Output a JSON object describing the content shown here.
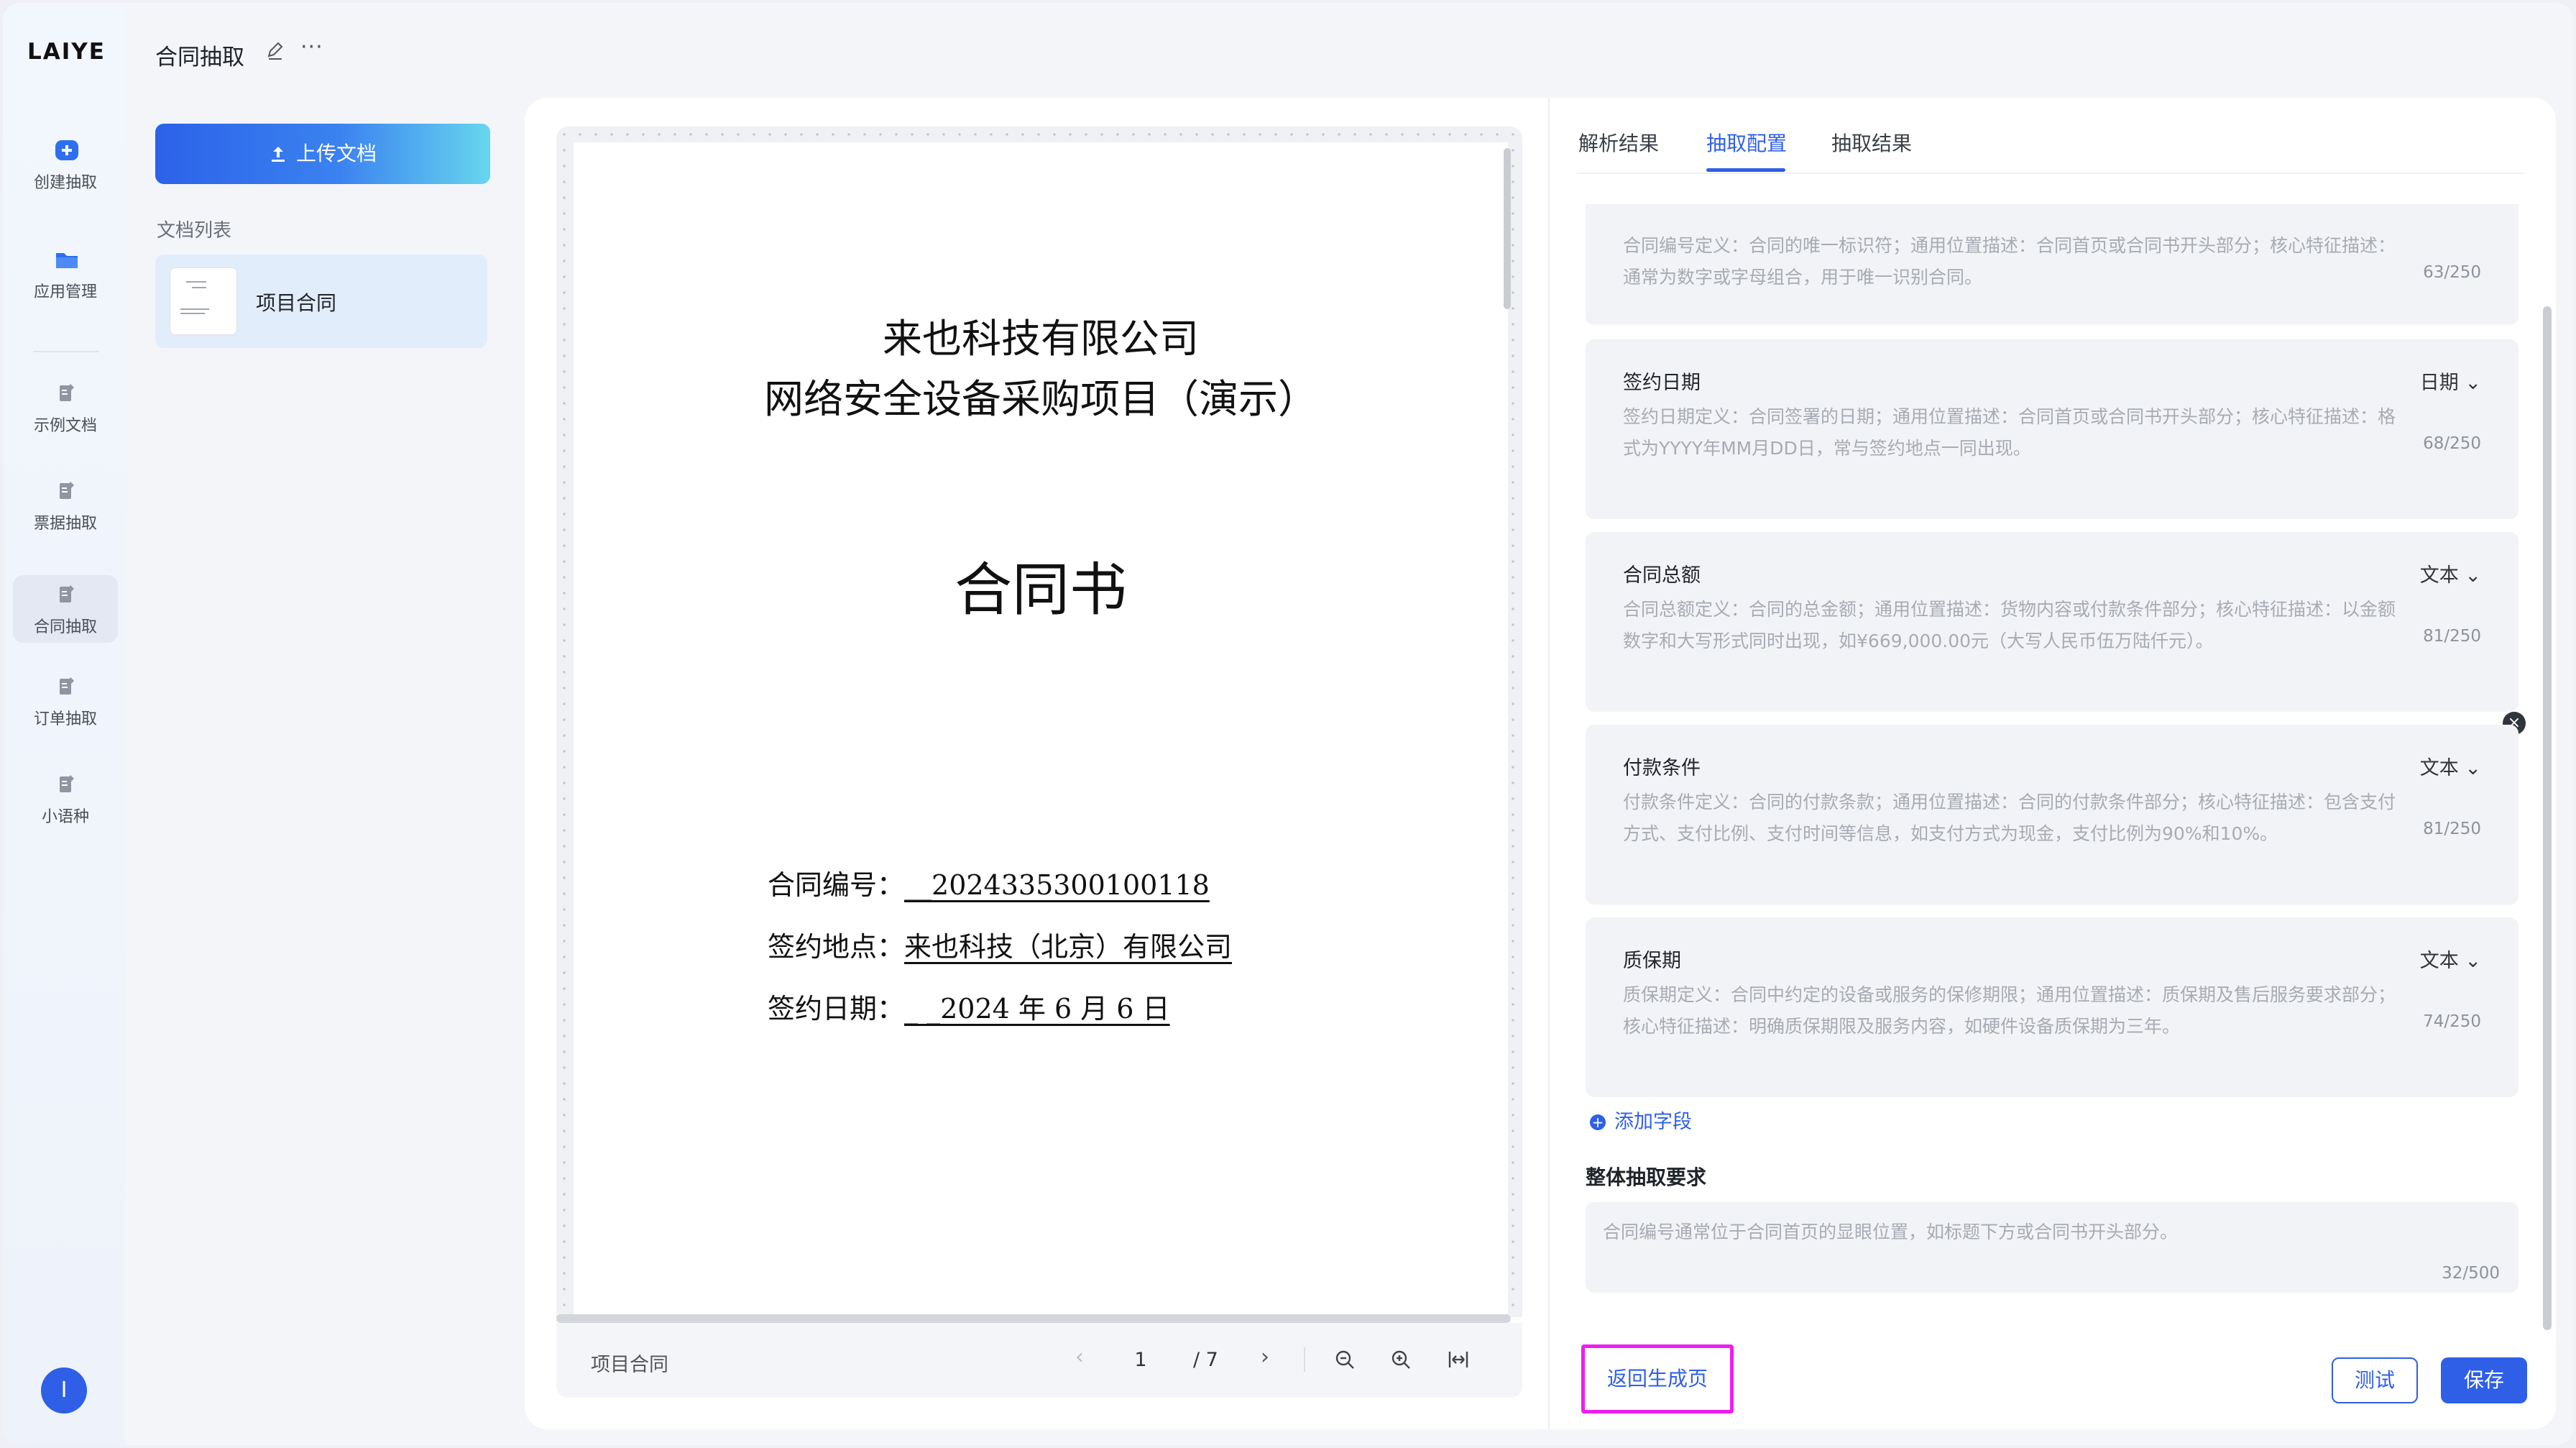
{
  "brand": {
    "logo": "LAIYE"
  },
  "nav": {
    "items": [
      {
        "label": "创建抽取",
        "icon": "plus-circle-icon"
      },
      {
        "label": "应用管理",
        "icon": "folder-icon"
      },
      {
        "label": "示例文档",
        "icon": "document-edit-icon"
      },
      {
        "label": "票据抽取",
        "icon": "document-edit-icon"
      },
      {
        "label": "合同抽取",
        "icon": "document-edit-icon",
        "active": true
      },
      {
        "label": "订单抽取",
        "icon": "document-edit-icon"
      },
      {
        "label": "小语种",
        "icon": "document-edit-icon"
      }
    ],
    "avatar": "I"
  },
  "header": {
    "title": "合同抽取",
    "more": "···"
  },
  "doclist": {
    "upload_label": "上传文档",
    "title": "文档列表",
    "items": [
      {
        "name": "项目合同"
      }
    ]
  },
  "document": {
    "company": "来也科技有限公司",
    "project": "网络安全设备采购项目（演示）",
    "heading": "合同书",
    "fields": [
      {
        "label": "合同编号：",
        "value": "__2024335300100118"
      },
      {
        "label": "签约地点：",
        "value": "来也科技（北京）有限公司"
      },
      {
        "label": "签约日期：",
        "value": "_ _2024 年 6 月 6 日"
      }
    ]
  },
  "pager": {
    "name": "项目合同",
    "current": "1",
    "total": "/ 7",
    "prev": "‹",
    "next": "›"
  },
  "tabs": [
    {
      "label": "解析结果"
    },
    {
      "label": "抽取配置",
      "active": true
    },
    {
      "label": "抽取结果"
    }
  ],
  "fields": [
    {
      "desc": "合同编号定义：合同的唯一标识符；通用位置描述：合同首页或合同书开头部分；核心特征描述：通常为数字或字母组合，用于唯一识别合同。",
      "count": "63/250"
    },
    {
      "title": "签约日期",
      "type": "日期",
      "desc": "签约日期定义：合同签署的日期；通用位置描述：合同首页或合同书开头部分；核心特征描述：格式为YYYY年MM月DD日，常与签约地点一同出现。",
      "count": "68/250"
    },
    {
      "title": "合同总额",
      "type": "文本",
      "desc": "合同总额定义：合同的总金额；通用位置描述：货物内容或付款条件部分；核心特征描述：以金额数字和大写形式同时出现，如¥669,000.00元（大写人民币伍万陆仟元）。",
      "count": "81/250"
    },
    {
      "title": "付款条件",
      "type": "文本",
      "desc": "付款条件定义：合同的付款条款；通用位置描述：合同的付款条件部分；核心特征描述：包含支付方式、支付比例、支付时间等信息，如支付方式为现金，支付比例为90%和10%。",
      "count": "81/250"
    },
    {
      "title": "质保期",
      "type": "文本",
      "desc": "质保期定义：合同中约定的设备或服务的保修期限；通用位置描述：质保期及售后服务要求部分；核心特征描述：明确质保期限及服务内容，如硬件设备质保期为三年。",
      "count": "74/250"
    }
  ],
  "add_field": "添加字段",
  "requirements": {
    "title": "整体抽取要求",
    "text": "合同编号通常位于合同首页的显眼位置，如标题下方或合同书开头部分。",
    "count": "32/500"
  },
  "actions": {
    "back": "返回生成页",
    "test": "测试",
    "save": "保存"
  },
  "colors": {
    "accent": "#2e5fe6",
    "highlight": "#ee1df0"
  }
}
